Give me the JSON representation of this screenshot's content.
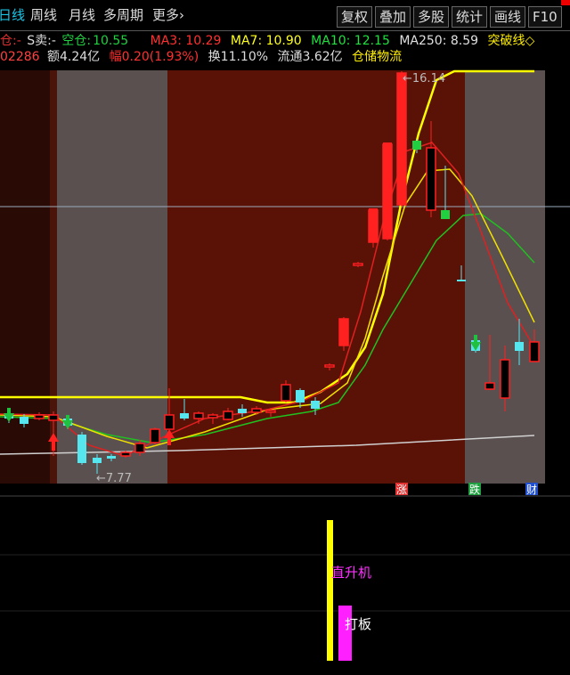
{
  "toolbar": {
    "tabs": [
      "日线",
      "周线",
      "月线",
      "多周期",
      "更多"
    ],
    "more_arrow": "›",
    "buttons": [
      "复权",
      "叠加",
      "多股",
      "统计",
      "画线",
      "F10"
    ]
  },
  "info_line1": {
    "buy_label": "仓:",
    "buy_value": "-",
    "sell_label": "S卖:",
    "sell_value": "-",
    "empty_label": "空仓:",
    "empty_value": "10.55",
    "ma3": "MA3: 10.29",
    "ma7": "MA7: 10.90",
    "ma10": "MA10: 12.15",
    "ma250": "MA250: 8.59",
    "breakout": "突破线◇"
  },
  "info_line2": {
    "code_fragment": "02286",
    "amount": "额4.24亿",
    "change": "幅0.20(1.93%)",
    "turnover": "换11.10%",
    "float": "流通3.62亿",
    "sector": "仓储物流"
  },
  "chart": {
    "high_label": "←16.14",
    "low_label": "←7.77",
    "markers": [
      {
        "text": "涨",
        "color": "#e03030"
      },
      {
        "text": "跌",
        "color": "#1f9f3f"
      },
      {
        "text": "财",
        "color": "#2050d0"
      }
    ],
    "signal_labels": {
      "straight_up": "直升机",
      "limit_up": "打板"
    },
    "colors": {
      "up": "#ff2020",
      "down": "#55e6f0",
      "ma3": "#e02020",
      "ma7": "#f0e000",
      "ma10": "#20c020",
      "ma250": "#d0d0d0",
      "breakout": "#ffff00"
    }
  }
}
